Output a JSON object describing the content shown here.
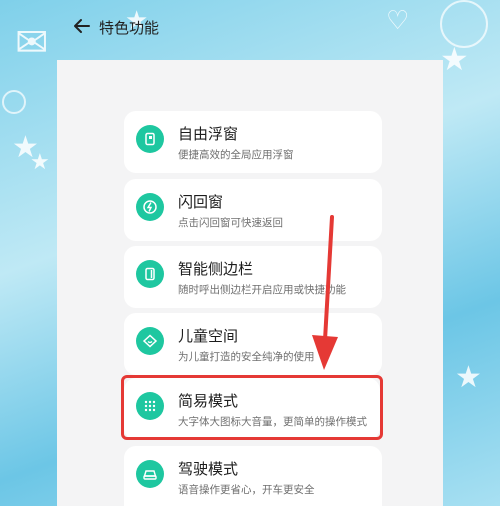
{
  "header": {
    "title": "特色功能"
  },
  "features": [
    {
      "name": "自由浮窗",
      "desc": "便捷高效的全局应用浮窗",
      "icon": "floating-window-icon"
    },
    {
      "name": "闪回窗",
      "desc": "点击闪回窗可快速返回",
      "icon": "flashback-icon"
    },
    {
      "name": "智能侧边栏",
      "desc": "随时呼出侧边栏开启应用或快捷功能",
      "icon": "sidebar-icon"
    },
    {
      "name": "儿童空间",
      "desc": "为儿童打造的安全纯净的使用",
      "icon": "kids-space-icon"
    },
    {
      "name": "简易模式",
      "desc": "大字体大图标大音量，更简单的操作模式",
      "icon": "simple-mode-icon"
    },
    {
      "name": "驾驶模式",
      "desc": "语音操作更省心，开车更安全",
      "icon": "driving-mode-icon"
    }
  ],
  "colors": {
    "accent": "#1ec7a0",
    "highlight": "#e53935",
    "arrow": "#e53935"
  }
}
